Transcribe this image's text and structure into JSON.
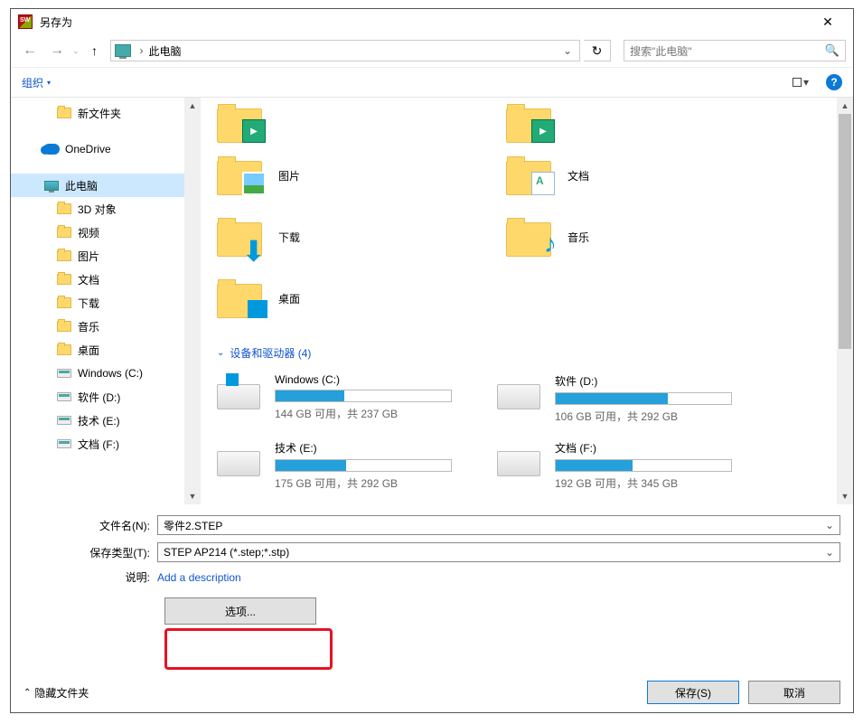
{
  "window": {
    "title": "另存为",
    "close": "✕"
  },
  "nav": {
    "back": "←",
    "fwd": "→",
    "up": "↑",
    "chevron": "›",
    "location": "此电脑",
    "dropdown": "⌄",
    "refresh": "↻",
    "search_placeholder": "搜索\"此电脑\""
  },
  "toolbar": {
    "organize": "组织",
    "dd": "▾",
    "help": "?"
  },
  "navpane": {
    "items": [
      {
        "label": "新文件夹",
        "kind": "folder",
        "indent": 2
      },
      {
        "label": "OneDrive",
        "kind": "onedrive",
        "indent": 1,
        "space_before": true
      },
      {
        "label": "此电脑",
        "kind": "pc",
        "indent": 1,
        "selected": true,
        "space_before": true
      },
      {
        "label": "3D 对象",
        "kind": "folder",
        "indent": 2
      },
      {
        "label": "视频",
        "kind": "folder",
        "indent": 2
      },
      {
        "label": "图片",
        "kind": "folder",
        "indent": 2
      },
      {
        "label": "文档",
        "kind": "folder",
        "indent": 2
      },
      {
        "label": "下载",
        "kind": "folder",
        "indent": 2
      },
      {
        "label": "音乐",
        "kind": "folder",
        "indent": 2
      },
      {
        "label": "桌面",
        "kind": "folder",
        "indent": 2
      },
      {
        "label": "Windows (C:)",
        "kind": "drive",
        "indent": 2
      },
      {
        "label": "软件 (D:)",
        "kind": "drive",
        "indent": 2
      },
      {
        "label": "技术 (E:)",
        "kind": "drive",
        "indent": 2
      },
      {
        "label": "文档 (F:)",
        "kind": "drive",
        "indent": 2
      }
    ]
  },
  "folders_row1": [
    {
      "label": "",
      "overlay": "vid"
    },
    {
      "label": "",
      "overlay": "vid2"
    }
  ],
  "folders": [
    {
      "label": "图片",
      "overlay": "pic"
    },
    {
      "label": "文档",
      "overlay": "doc"
    },
    {
      "label": "下载",
      "overlay": "dl"
    },
    {
      "label": "音乐",
      "overlay": "music"
    },
    {
      "label": "桌面",
      "overlay": "desk"
    }
  ],
  "devices_header": "设备和驱动器 (4)",
  "drives": [
    {
      "name": "Windows (C:)",
      "fill_pct": 39,
      "stat": "144 GB 可用，共 237 GB",
      "win": true
    },
    {
      "name": "软件 (D:)",
      "fill_pct": 64,
      "stat": "106 GB 可用，共 292 GB"
    },
    {
      "name": "技术 (E:)",
      "fill_pct": 40,
      "stat": "175 GB 可用，共 292 GB"
    },
    {
      "name": "文档 (F:)",
      "fill_pct": 44,
      "stat": "192 GB 可用，共 345 GB"
    }
  ],
  "form": {
    "filename_label": "文件名(N):",
    "filename_value": "零件2.STEP",
    "type_label": "保存类型(T):",
    "type_value": "STEP AP214 (*.step;*.stp)",
    "desc_label": "说明:",
    "desc_link": "Add a description",
    "options": "选项..."
  },
  "footer": {
    "hide": "隐藏文件夹",
    "save": "保存(S)",
    "cancel": "取消"
  }
}
